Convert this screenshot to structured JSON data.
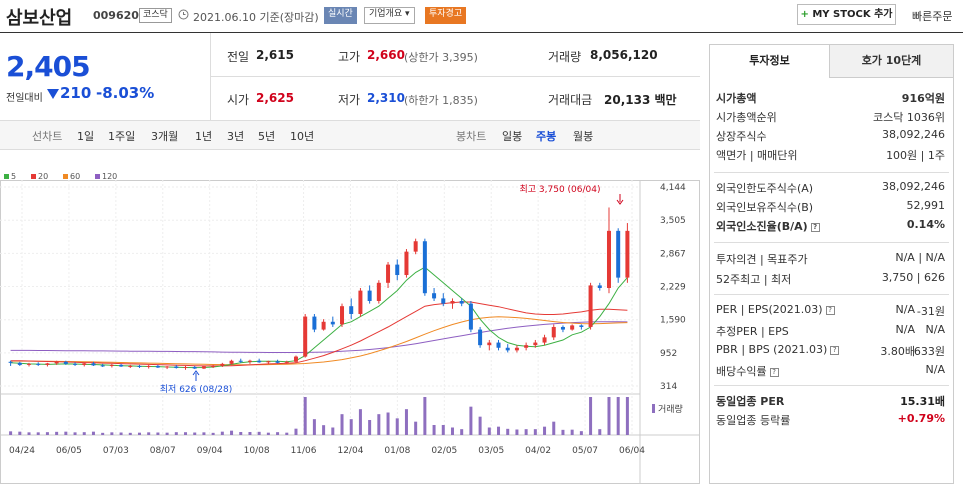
{
  "header": {
    "title": "삼보산업",
    "code": "009620",
    "market": "코스닥",
    "date_text": "2021.06.10 기준(장마감)",
    "buttons": [
      "실시간",
      "기업개요 ▾",
      "투자경고"
    ],
    "button_colors": [
      "#6a86b4",
      "#ffffff",
      "#e87722"
    ],
    "mystock": "MY STOCK 추가",
    "quick_order": "빠른주문"
  },
  "summary": {
    "price": "2,405",
    "change_label": "전일대비",
    "change_value": "210",
    "change_pct": "-8.03%",
    "prev_label": "전일",
    "prev": "2,615",
    "open_label": "시가",
    "open": "2,625",
    "high_label": "고가",
    "high": "2,660",
    "upper_limit": "(상한가 3,395)",
    "low_label": "저가",
    "low": "2,310",
    "lower_limit": "(하한가 1,835)",
    "volume_label": "거래량",
    "volume": "8,056,120",
    "amount_label": "거래대금",
    "amount": "20,133 백만"
  },
  "periods": {
    "line_label": "선차트",
    "line_items": [
      "1일",
      "1주일",
      "3개월",
      "1년",
      "3년",
      "5년",
      "10년"
    ],
    "candle_label": "봉차트",
    "candle_items": [
      "일봉",
      "주봉",
      "월봉"
    ],
    "active_candle": "주봉"
  },
  "chart_data": {
    "type": "candlestick",
    "legend": [
      {
        "name": "5",
        "color": "#3cb043"
      },
      {
        "name": "20",
        "color": "#e53935"
      },
      {
        "name": "60",
        "color": "#f08a24"
      },
      {
        "name": "120",
        "color": "#8e5fc2"
      }
    ],
    "y_ticks": [
      "4,144",
      "3,505",
      "2,867",
      "2,229",
      "1,590",
      "952",
      "314"
    ],
    "y_min": 314,
    "y_max": 4144,
    "x_labels": [
      "04/24",
      "06/05",
      "07/03",
      "08/07",
      "09/04",
      "10/08",
      "11/06",
      "12/04",
      "01/08",
      "02/05",
      "03/05",
      "04/02",
      "05/07",
      "06/04"
    ],
    "high_annotation": "최고 3,750 (06/04)",
    "low_annotation": "최저 626 (08/28)",
    "volume_label": "거래량",
    "candles": [
      [
        780,
        800,
        700,
        760
      ],
      [
        760,
        780,
        700,
        720
      ],
      [
        720,
        760,
        690,
        740
      ],
      [
        740,
        770,
        700,
        720
      ],
      [
        720,
        760,
        690,
        750
      ],
      [
        750,
        800,
        720,
        780
      ],
      [
        780,
        800,
        720,
        740
      ],
      [
        740,
        770,
        700,
        720
      ],
      [
        720,
        760,
        690,
        750
      ],
      [
        750,
        780,
        700,
        710
      ],
      [
        710,
        740,
        680,
        700
      ],
      [
        700,
        740,
        670,
        720
      ],
      [
        720,
        740,
        680,
        690
      ],
      [
        690,
        720,
        660,
        700
      ],
      [
        700,
        720,
        660,
        680
      ],
      [
        680,
        720,
        650,
        700
      ],
      [
        700,
        720,
        660,
        670
      ],
      [
        670,
        700,
        640,
        690
      ],
      [
        690,
        720,
        650,
        660
      ],
      [
        660,
        700,
        626,
        680
      ],
      [
        680,
        700,
        640,
        650
      ],
      [
        650,
        700,
        640,
        690
      ],
      [
        690,
        720,
        660,
        700
      ],
      [
        700,
        760,
        680,
        740
      ],
      [
        740,
        820,
        720,
        800
      ],
      [
        800,
        840,
        760,
        780
      ],
      [
        780,
        820,
        740,
        800
      ],
      [
        800,
        840,
        760,
        770
      ],
      [
        770,
        800,
        740,
        790
      ],
      [
        790,
        820,
        750,
        760
      ],
      [
        760,
        800,
        740,
        780
      ],
      [
        780,
        900,
        760,
        880
      ],
      [
        880,
        1700,
        860,
        1650
      ],
      [
        1650,
        1700,
        1350,
        1400
      ],
      [
        1400,
        1600,
        1380,
        1550
      ],
      [
        1550,
        1650,
        1450,
        1500
      ],
      [
        1500,
        1900,
        1450,
        1850
      ],
      [
        1850,
        2000,
        1600,
        1700
      ],
      [
        1700,
        2200,
        1650,
        2150
      ],
      [
        2150,
        2250,
        1900,
        1950
      ],
      [
        1950,
        2350,
        1900,
        2300
      ],
      [
        2300,
        2700,
        2200,
        2650
      ],
      [
        2650,
        2750,
        2350,
        2450
      ],
      [
        2450,
        2950,
        2400,
        2900
      ],
      [
        2900,
        3150,
        2850,
        3100
      ],
      [
        3100,
        3150,
        2050,
        2100
      ],
      [
        2100,
        2200,
        1950,
        2000
      ],
      [
        2000,
        2100,
        1850,
        1900
      ],
      [
        1900,
        2000,
        1800,
        1950
      ],
      [
        1950,
        2000,
        1850,
        1900
      ],
      [
        1900,
        1950,
        1350,
        1400
      ],
      [
        1400,
        1450,
        1050,
        1100
      ],
      [
        1100,
        1200,
        1000,
        1150
      ],
      [
        1150,
        1200,
        1000,
        1050
      ],
      [
        1050,
        1120,
        960,
        1000
      ],
      [
        1000,
        1100,
        960,
        1050
      ],
      [
        1050,
        1150,
        1000,
        1100
      ],
      [
        1100,
        1200,
        1050,
        1150
      ],
      [
        1150,
        1300,
        1100,
        1250
      ],
      [
        1250,
        1500,
        1200,
        1450
      ],
      [
        1450,
        1480,
        1350,
        1400
      ],
      [
        1400,
        1500,
        1380,
        1480
      ],
      [
        1480,
        1500,
        1400,
        1450
      ],
      [
        1450,
        2300,
        1400,
        2250
      ],
      [
        2250,
        2300,
        2150,
        2200
      ],
      [
        2200,
        3750,
        2100,
        3300
      ],
      [
        3300,
        3350,
        2300,
        2400
      ],
      [
        2400,
        3450,
        2300,
        3300
      ]
    ],
    "ma5": [
      760,
      750,
      740,
      735,
      730,
      735,
      740,
      738,
      730,
      728,
      720,
      712,
      705,
      700,
      695,
      690,
      688,
      680,
      676,
      670,
      668,
      670,
      680,
      700,
      730,
      760,
      780,
      790,
      790,
      790,
      780,
      800,
      900,
      1050,
      1200,
      1350,
      1500,
      1550,
      1650,
      1750,
      1850,
      2000,
      2150,
      2350,
      2500,
      2600,
      2450,
      2300,
      2150,
      2000,
      1850,
      1600,
      1400,
      1250,
      1150,
      1100,
      1080,
      1070,
      1100,
      1150,
      1200,
      1300,
      1350,
      1450,
      1650,
      1900,
      2200,
      2400
    ],
    "ma20": [
      800,
      800,
      795,
      790,
      785,
      780,
      775,
      770,
      765,
      760,
      755,
      750,
      745,
      740,
      735,
      730,
      725,
      720,
      715,
      710,
      705,
      700,
      700,
      700,
      705,
      710,
      720,
      730,
      740,
      745,
      750,
      760,
      800,
      850,
      900,
      960,
      1030,
      1100,
      1180,
      1270,
      1360,
      1450,
      1550,
      1650,
      1750,
      1850,
      1880,
      1900,
      1920,
      1930,
      1930,
      1900,
      1870,
      1840,
      1800,
      1760,
      1720,
      1700,
      1690,
      1690,
      1700,
      1720,
      1740,
      1770,
      1790,
      1790,
      1780,
      1770
    ]
  },
  "right_panel": {
    "tabs": [
      "투자정보",
      "호가 10단계"
    ],
    "rows1": [
      {
        "label": "시가총액",
        "value": "916억원"
      },
      {
        "label": "시가총액순위",
        "value": "코스닥 1036위"
      },
      {
        "label": "상장주식수",
        "value": "38,092,246"
      },
      {
        "label": "액면가 | 매매단위",
        "value": "100원 | 1주"
      }
    ],
    "rows2": [
      {
        "label": "외국인한도주식수(A)",
        "value": "38,092,246"
      },
      {
        "label": "외국인보유주식수(B)",
        "value": "52,991"
      },
      {
        "label": "외국인소진율(B/A)",
        "value": "0.14%"
      }
    ],
    "rows3": [
      {
        "label": "투자의견 | 목표주가",
        "value": "N/A | N/A"
      },
      {
        "label": "52주최고 | 최저",
        "value": "3,750 | 626"
      }
    ],
    "rows4": [
      {
        "label": "PER | EPS(2021.03)",
        "v1": "N/A",
        "v2": "-31원"
      },
      {
        "label": "추정PER | EPS",
        "v1": "N/A",
        "v2": "N/A"
      },
      {
        "label": "PBR | BPS (2021.03)",
        "v1": "3.80배",
        "v2": "633원"
      },
      {
        "label": "배당수익률",
        "v1": "",
        "v2": "N/A"
      }
    ],
    "rows5": [
      {
        "label": "동일업종 PER",
        "value": "15.31배"
      },
      {
        "label": "동일업종 등락률",
        "value": "+0.79%"
      }
    ]
  }
}
